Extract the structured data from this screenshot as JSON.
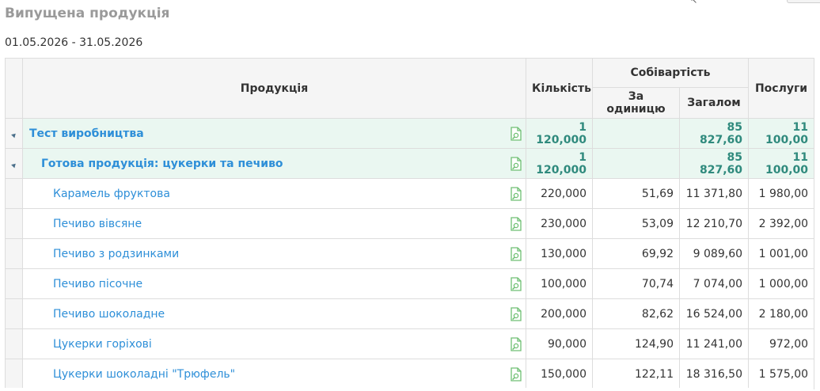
{
  "page": {
    "title": "Випущена продукція",
    "period": "01.05.2026 - 31.05.2026"
  },
  "table": {
    "headers": {
      "product": "Продукція",
      "quantity": "Кількість",
      "cost": "Собівартість",
      "cost_per_unit": "За одиницю",
      "cost_total": "Загалом",
      "services": "Послуги"
    },
    "rows": [
      {
        "name": "Тест виробництва",
        "quantity": "1 120,000",
        "unit_cost": "",
        "total": "85 827,60",
        "services": "11 100,00",
        "group": true,
        "level": 0
      },
      {
        "name": "Готова продукція: цукерки та печиво",
        "quantity": "1 120,000",
        "unit_cost": "",
        "total": "85 827,60",
        "services": "11 100,00",
        "group": true,
        "level": 1
      },
      {
        "name": "Карамель фруктова",
        "quantity": "220,000",
        "unit_cost": "51,69",
        "total": "11 371,80",
        "services": "1 980,00",
        "group": false,
        "level": 2
      },
      {
        "name": "Печиво вівсяне",
        "quantity": "230,000",
        "unit_cost": "53,09",
        "total": "12 210,70",
        "services": "2 392,00",
        "group": false,
        "level": 2
      },
      {
        "name": "Печиво з родзинками",
        "quantity": "130,000",
        "unit_cost": "69,92",
        "total": "9 089,60",
        "services": "1 001,00",
        "group": false,
        "level": 2
      },
      {
        "name": "Печиво пісочне",
        "quantity": "100,000",
        "unit_cost": "70,74",
        "total": "7 074,00",
        "services": "1 000,00",
        "group": false,
        "level": 2
      },
      {
        "name": "Печиво шоколадне",
        "quantity": "200,000",
        "unit_cost": "82,62",
        "total": "16 524,00",
        "services": "2 180,00",
        "group": false,
        "level": 2
      },
      {
        "name": "Цукерки горіхові",
        "quantity": "90,000",
        "unit_cost": "124,90",
        "total": "11 241,00",
        "services": "972,00",
        "group": false,
        "level": 2
      },
      {
        "name": "Цукерки шоколадні \"Трюфель\"",
        "quantity": "150,000",
        "unit_cost": "122,11",
        "total": "18 316,50",
        "services": "1 575,00",
        "group": false,
        "level": 2
      }
    ]
  },
  "icons": {
    "expand": "collapse-triangle-icon",
    "document": "document-report-icon"
  },
  "colors": {
    "link": "#2e8fd8",
    "group_background": "#eaf7f1",
    "group_number": "#2f8a7d",
    "icon_green": "#6fbf73",
    "header_background": "#f5f5f5",
    "title": "#9a9a9a"
  }
}
